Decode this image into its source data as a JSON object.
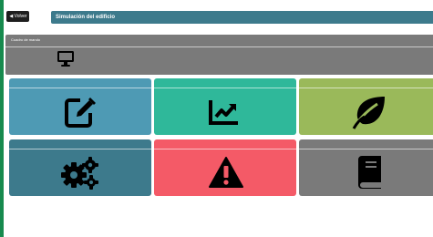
{
  "header": {
    "back_label": "◀ Volver",
    "title": "Simulación del edificio"
  },
  "panel": {
    "label": "Cuadro de mando",
    "icon": "monitor-icon",
    "color": "#7a7a7a"
  },
  "tiles": [
    {
      "icon": "edit-icon",
      "color": "#4e9ab4"
    },
    {
      "icon": "chart-line-icon",
      "color": "#2fb89a"
    },
    {
      "icon": "leaf-icon",
      "color": "#9ab95a"
    },
    {
      "icon": "cogs-icon",
      "color": "#3d7a8c"
    },
    {
      "icon": "warning-icon",
      "color": "#f45a67"
    },
    {
      "icon": "book-icon",
      "color": "#7a7a7a"
    }
  ]
}
